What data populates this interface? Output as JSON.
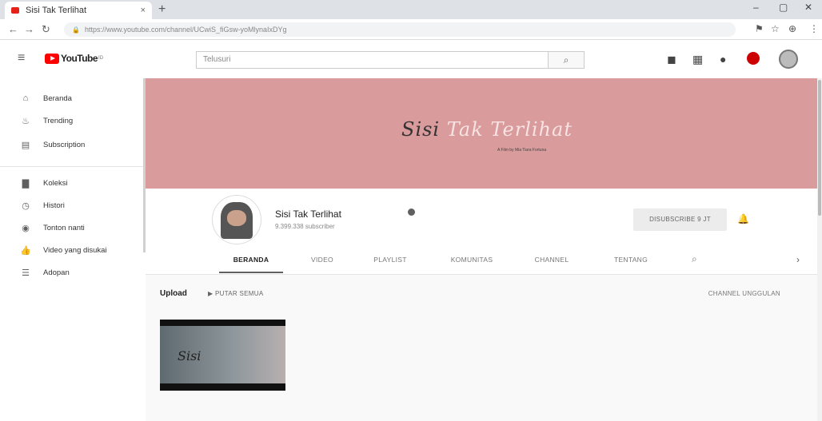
{
  "browser": {
    "tab_title": "Sisi Tak Terlihat",
    "tab_close": "×",
    "new_tab": "+",
    "url": "https://www.youtube.com/channel/UCwiS_fiGsw-yoMlynaIxDYg",
    "window_controls": [
      "–",
      "▢",
      "✕"
    ]
  },
  "header": {
    "logo_text": "YouTube",
    "logo_sup": "ID",
    "search_placeholder": "Telusuri",
    "icons": [
      "video-camera-icon",
      "apps-grid-icon",
      "messages-icon",
      "notifications-icon",
      "account-avatar"
    ]
  },
  "sidebar": {
    "items": [
      {
        "label": "Beranda",
        "icon": "home-icon",
        "glyph": "⌂"
      },
      {
        "label": "Trending",
        "icon": "flame-icon",
        "glyph": "♨"
      },
      {
        "label": "Subscription",
        "icon": "subscriptions-icon",
        "glyph": "▤"
      },
      {
        "label": "Koleksi",
        "icon": "folder-icon",
        "glyph": "▇"
      },
      {
        "label": "Histori",
        "icon": "history-icon",
        "glyph": "◷"
      },
      {
        "label": "Tonton nanti",
        "icon": "clock-icon",
        "glyph": "◉"
      },
      {
        "label": "Video yang disukai",
        "icon": "thumbs-up-icon",
        "glyph": "👍"
      },
      {
        "label": "Adopan",
        "icon": "playlist-icon",
        "glyph": "☰"
      }
    ]
  },
  "banner": {
    "title_part1": "Sisi",
    "title_part2": "Tak Terlihat",
    "subtitle": "A Film by Mia Tiara Fortuna"
  },
  "channel": {
    "name": "Sisi Tak Terlihat",
    "subscribers": "9.399.338 subscriber",
    "subscribe_label": "DISUBSCRIBE  9 JT",
    "tabs": [
      "BERANDA",
      "VIDEO",
      "PLAYLIST",
      "KOMUNITAS",
      "CHANNEL",
      "TENTANG"
    ],
    "active_tab": "BERANDA"
  },
  "content": {
    "section_title": "Upload",
    "play_all": "▶  PUTAR SEMUA",
    "featured_channels": "CHANNEL UNGGULAN",
    "thumbnail_text": "Sisi"
  },
  "colors": {
    "banner": "#d99b9b",
    "youtube_red": "#ff0000"
  }
}
